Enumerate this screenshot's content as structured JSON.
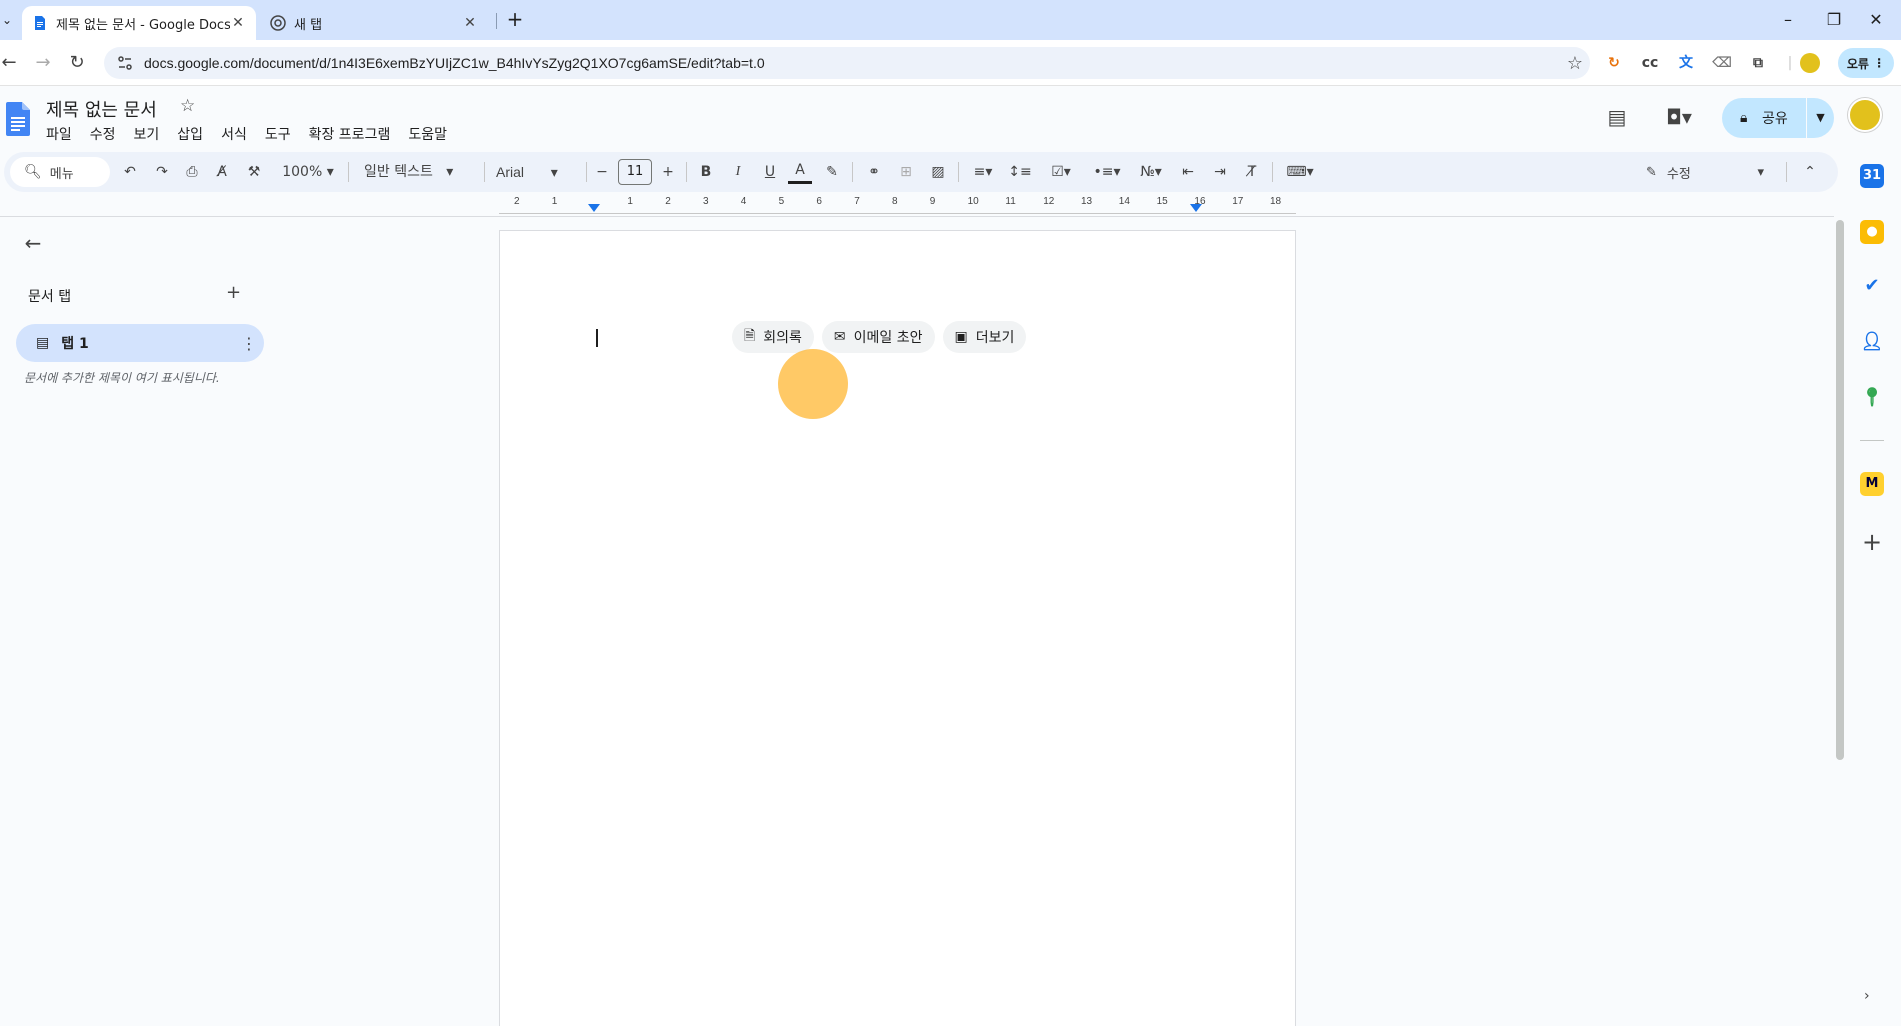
{
  "browser": {
    "tabs": [
      {
        "title": "제목 없는 문서 - Google Docs",
        "active": true
      },
      {
        "title": "새 탭",
        "active": false
      }
    ],
    "url": "docs.google.com/document/d/1n4I3E6xemBzYUIjZC1w_B4hIvYsZyg2Q1XO7cg6amSE/edit?tab=t.0",
    "profile_label": "오류",
    "extensions": [
      "refresh-extension-icon",
      "cc-icon",
      "translate-icon",
      "eraser-icon",
      "puzzle-icon",
      "account-circle-icon"
    ]
  },
  "docs": {
    "title": "제목 없는 문서",
    "menu": [
      "파일",
      "수정",
      "보기",
      "삽입",
      "서식",
      "도구",
      "확장 프로그램",
      "도움말"
    ],
    "share_label": "공유"
  },
  "toolbar": {
    "search_label": "메뉴",
    "zoom": "100%",
    "style": "일반 텍스트",
    "font": "Arial",
    "font_size": "11",
    "mode": "수정"
  },
  "ruler": {
    "marks": [
      "2",
      "1",
      "",
      "1",
      "2",
      "3",
      "4",
      "5",
      "6",
      "7",
      "8",
      "9",
      "10",
      "11",
      "12",
      "13",
      "14",
      "15",
      "16",
      "17",
      "18"
    ]
  },
  "sidebar": {
    "heading": "문서 탭",
    "tab_label": "탭 1",
    "hint": "문서에 추가한 제목이 여기 표시됩니다."
  },
  "page": {
    "chips": [
      {
        "label": "회의록",
        "icon": "document-icon"
      },
      {
        "label": "이메일 초안",
        "icon": "email-draft-icon"
      },
      {
        "label": "더보기",
        "icon": "more-templates-icon"
      }
    ]
  },
  "colors": {
    "tabbar": "#d3e3fd",
    "toolbar": "#edf2fa",
    "accent": "#1a73e8",
    "share": "#c2e7ff",
    "cursor_highlight": "#ffb733"
  }
}
